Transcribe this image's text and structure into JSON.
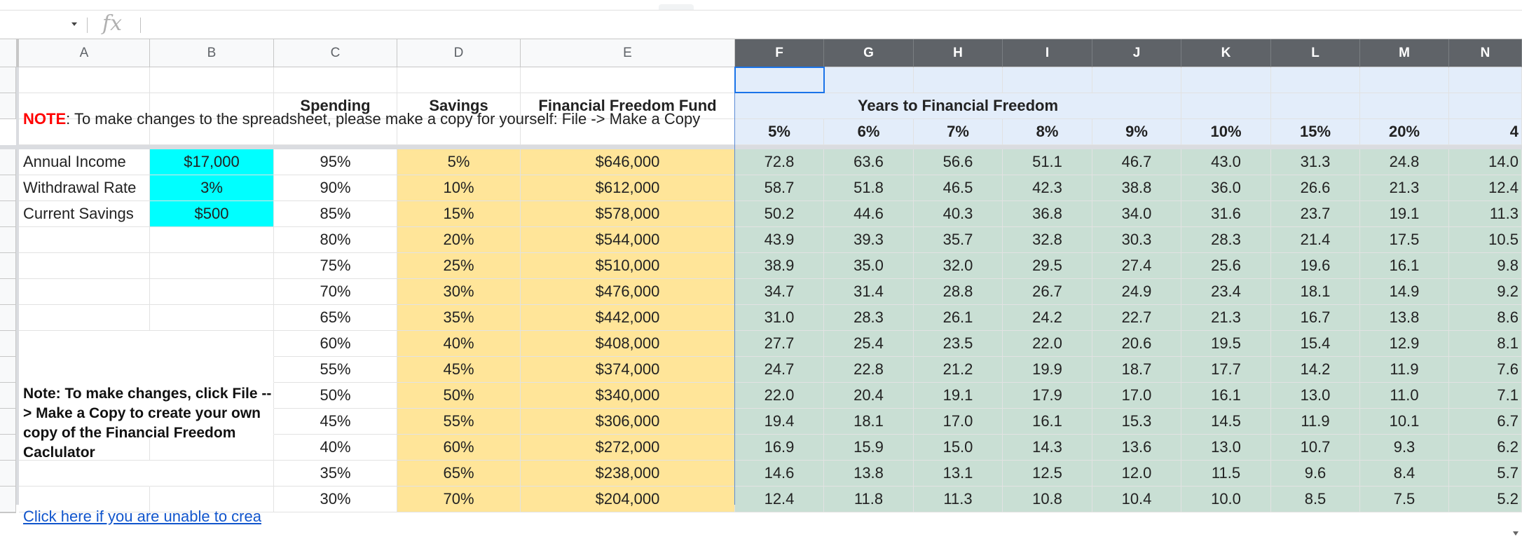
{
  "formula_bar": {
    "fx_label": "fx",
    "value": ""
  },
  "columns": [
    "A",
    "B",
    "C",
    "D",
    "E",
    "F",
    "G",
    "H",
    "I",
    "J",
    "K",
    "L",
    "M",
    "N"
  ],
  "note_top": {
    "prefix": "NOTE",
    "text": ": To make changes to the spreadsheet, please make a copy for yourself:  File -> Make a Copy"
  },
  "headers": {
    "spending": "Spending",
    "savings": "Savings",
    "fund": "Financial Freedom Fund",
    "years": "Years to Financial Freedom",
    "returns": [
      "5%",
      "6%",
      "7%",
      "8%",
      "9%",
      "10%",
      "15%",
      "20%",
      "4"
    ]
  },
  "inputs": [
    {
      "label": "Annual Income",
      "value": "$17,000"
    },
    {
      "label": "Withdrawal Rate",
      "value": "3%"
    },
    {
      "label": "Current Savings",
      "value": "$500"
    }
  ],
  "instructions": "Note:  To make changes, click File --> Make a Copy to create your own copy of the Financial Freedom Caclulator",
  "link_text": "Click here if you are unable to crea",
  "rows": [
    {
      "spending": "95%",
      "savings": "5%",
      "fund": "$646,000",
      "years": [
        "72.8",
        "63.6",
        "56.6",
        "51.1",
        "46.7",
        "43.0",
        "31.3",
        "24.8",
        "14.0"
      ]
    },
    {
      "spending": "90%",
      "savings": "10%",
      "fund": "$612,000",
      "years": [
        "58.7",
        "51.8",
        "46.5",
        "42.3",
        "38.8",
        "36.0",
        "26.6",
        "21.3",
        "12.4"
      ]
    },
    {
      "spending": "85%",
      "savings": "15%",
      "fund": "$578,000",
      "years": [
        "50.2",
        "44.6",
        "40.3",
        "36.8",
        "34.0",
        "31.6",
        "23.7",
        "19.1",
        "11.3"
      ]
    },
    {
      "spending": "80%",
      "savings": "20%",
      "fund": "$544,000",
      "years": [
        "43.9",
        "39.3",
        "35.7",
        "32.8",
        "30.3",
        "28.3",
        "21.4",
        "17.5",
        "10.5"
      ]
    },
    {
      "spending": "75%",
      "savings": "25%",
      "fund": "$510,000",
      "years": [
        "38.9",
        "35.0",
        "32.0",
        "29.5",
        "27.4",
        "25.6",
        "19.6",
        "16.1",
        "9.8"
      ]
    },
    {
      "spending": "70%",
      "savings": "30%",
      "fund": "$476,000",
      "years": [
        "34.7",
        "31.4",
        "28.8",
        "26.7",
        "24.9",
        "23.4",
        "18.1",
        "14.9",
        "9.2"
      ]
    },
    {
      "spending": "65%",
      "savings": "35%",
      "fund": "$442,000",
      "years": [
        "31.0",
        "28.3",
        "26.1",
        "24.2",
        "22.7",
        "21.3",
        "16.7",
        "13.8",
        "8.6"
      ]
    },
    {
      "spending": "60%",
      "savings": "40%",
      "fund": "$408,000",
      "years": [
        "27.7",
        "25.4",
        "23.5",
        "22.0",
        "20.6",
        "19.5",
        "15.4",
        "12.9",
        "8.1"
      ]
    },
    {
      "spending": "55%",
      "savings": "45%",
      "fund": "$374,000",
      "years": [
        "24.7",
        "22.8",
        "21.2",
        "19.9",
        "18.7",
        "17.7",
        "14.2",
        "11.9",
        "7.6"
      ]
    },
    {
      "spending": "50%",
      "savings": "50%",
      "fund": "$340,000",
      "years": [
        "22.0",
        "20.4",
        "19.1",
        "17.9",
        "17.0",
        "16.1",
        "13.0",
        "11.0",
        "7.1"
      ]
    },
    {
      "spending": "45%",
      "savings": "55%",
      "fund": "$306,000",
      "years": [
        "19.4",
        "18.1",
        "17.0",
        "16.1",
        "15.3",
        "14.5",
        "11.9",
        "10.1",
        "6.7"
      ]
    },
    {
      "spending": "40%",
      "savings": "60%",
      "fund": "$272,000",
      "years": [
        "16.9",
        "15.9",
        "15.0",
        "14.3",
        "13.6",
        "13.0",
        "10.7",
        "9.3",
        "6.2"
      ]
    },
    {
      "spending": "35%",
      "savings": "65%",
      "fund": "$238,000",
      "years": [
        "14.6",
        "13.8",
        "13.1",
        "12.5",
        "12.0",
        "11.5",
        "9.6",
        "8.4",
        "5.7"
      ]
    },
    {
      "spending": "30%",
      "savings": "70%",
      "fund": "$204,000",
      "years": [
        "12.4",
        "11.8",
        "11.3",
        "10.8",
        "10.4",
        "10.0",
        "8.5",
        "7.5",
        "5.2"
      ]
    }
  ],
  "colors": {
    "input_bg": "#00ffff",
    "savings_bg": "#ffe599",
    "years_bg": "#c9dfd4",
    "header_bg": "#e3edfa",
    "note_red": "#ff0000",
    "link": "#1155cc"
  }
}
